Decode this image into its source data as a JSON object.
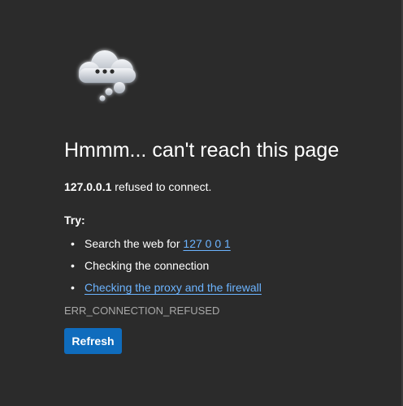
{
  "icon": "cloud-thinking-icon",
  "title": "Hmmm... can't reach this page",
  "subtitle": {
    "host": "127.0.0.1",
    "message": " refused to connect."
  },
  "try_heading": "Try:",
  "suggestions": [
    {
      "prefix": "Search the web for ",
      "link": "127 0 0 1"
    },
    {
      "prefix": "Checking the connection",
      "link": ""
    },
    {
      "prefix": "",
      "link": "Checking the proxy and the firewall"
    }
  ],
  "bullet": "•",
  "error_code": "ERR_CONNECTION_REFUSED",
  "refresh_label": "Refresh",
  "colors": {
    "background": "#2b2b2b",
    "link": "#6cb4ff",
    "button": "#0f6cbd",
    "muted_text": "#a8a8a8"
  }
}
